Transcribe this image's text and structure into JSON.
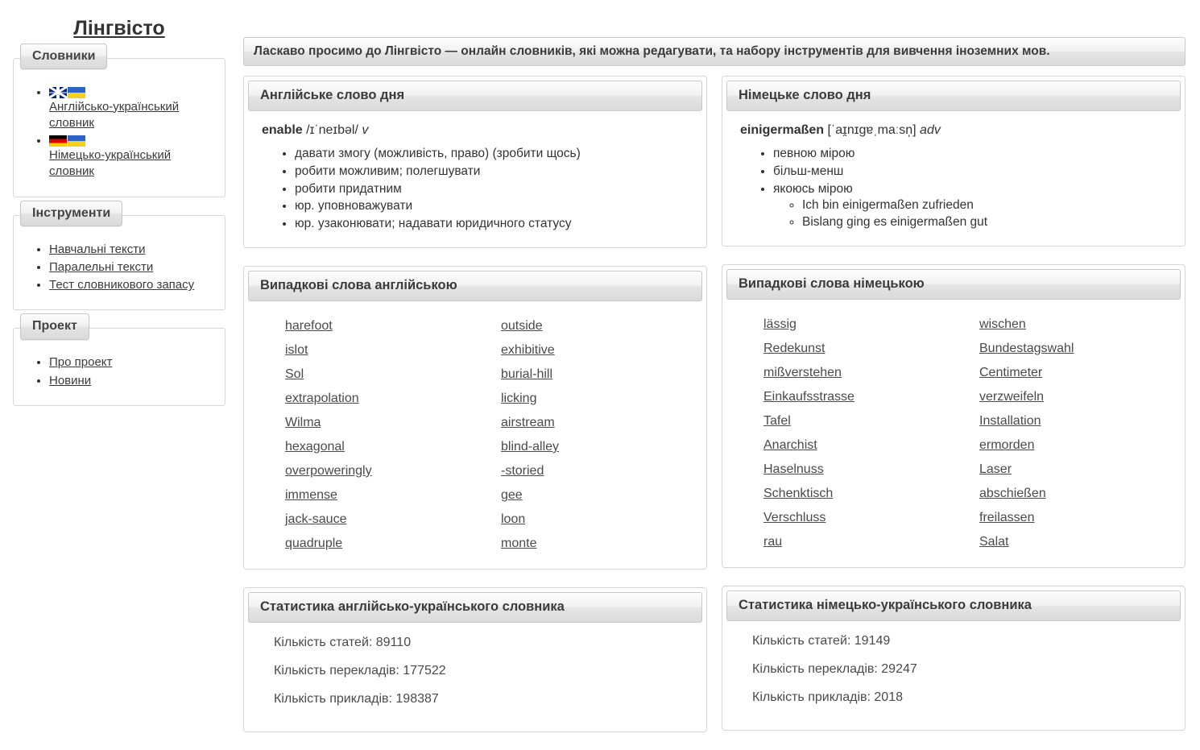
{
  "site": {
    "title": "Лінгвісто"
  },
  "welcome": {
    "text": "Ласкаво просимо до Лінгвісто — онлайн словників, які можна редагувати, та набору інструментів для вивчення іноземних мов."
  },
  "sidebar": {
    "sections": [
      {
        "legend": "Словники",
        "items": [
          {
            "label": "Англійсько-український словник",
            "flags": [
              "uk-flag-icon",
              "ua-flag-icon"
            ]
          },
          {
            "label": "Німецько-український словник",
            "flags": [
              "de-flag-icon",
              "ua-flag-icon"
            ]
          }
        ]
      },
      {
        "legend": "Інструменти",
        "items": [
          {
            "label": "Навчальні тексти"
          },
          {
            "label": "Паралельні тексти"
          },
          {
            "label": "Тест словникового запасу"
          }
        ]
      },
      {
        "legend": "Проект",
        "items": [
          {
            "label": "Про проект"
          },
          {
            "label": "Новини"
          }
        ]
      }
    ]
  },
  "panels": {
    "english_wotd": {
      "title": "Англійське слово дня",
      "lemma": "enable",
      "ipa": "/ɪˈneɪbəl/",
      "pos": "v",
      "senses": [
        "давати змогу (можливість, право) (зробити щось)",
        "робити можливим; полегшувати",
        "робити придатним",
        "юр. уповноважувати",
        "юр. узаконювати; надавати юридичного статусу"
      ]
    },
    "german_wotd": {
      "title": "Німецьке слово дня",
      "lemma": "einigermaßen",
      "ipa": "[ˈaɪ̯nɪgɐˌmaːsn̩]",
      "pos": "adv",
      "senses": [
        {
          "text": "певною мірою",
          "examples": []
        },
        {
          "text": "більш-менш",
          "examples": []
        },
        {
          "text": "якоюсь мірою",
          "examples": [
            "Ich bin einigermaßen zufrieden",
            "Bislang ging es einigermaßen gut"
          ]
        }
      ]
    },
    "random_english": {
      "title": "Випадкові слова англійською",
      "column_left": [
        "harefoot",
        "islot",
        "Sol",
        "extrapolation",
        "Wilma",
        "hexagonal",
        "overpoweringly",
        "immense",
        "jack-sauce",
        "quadruple"
      ],
      "column_right": [
        "outside",
        "exhibitive",
        "burial-hill",
        "licking",
        "airstream",
        "blind-alley",
        "-storied",
        "gee",
        "loon",
        "monte"
      ]
    },
    "random_german": {
      "title": "Випадкові слова німецькою",
      "column_left": [
        "lässig",
        "Redekunst",
        "mißverstehen",
        "Einkaufsstrasse",
        "Tafel",
        "Anarchist",
        "Haselnuss",
        "Schenktisch",
        "Verschluss",
        "rau"
      ],
      "column_right": [
        "wischen",
        "Bundestagswahl",
        "Centimeter",
        "verzweifeln",
        "Installation",
        "ermorden",
        "Laser",
        "abschießen",
        "freilassen",
        "Salat"
      ]
    },
    "stats_en_uk": {
      "title": "Статистика англійсько-українського словника",
      "lines": [
        "Кількість статей: 89110",
        "Кількість перекладів: 177522",
        "Кількість прикладів: 198387"
      ]
    },
    "stats_de_uk": {
      "title": "Статистика німецько-українського словника",
      "lines": [
        "Кількість статей: 19149",
        "Кількість перекладів: 29247",
        "Кількість прикладів: 2018"
      ]
    }
  },
  "colors": {
    "text": "#333333",
    "link": "#4a4a4a",
    "panel_border": "#d6d6d6",
    "header_gradient_top": "#fdfdfd",
    "header_gradient_bottom": "#dadada"
  }
}
